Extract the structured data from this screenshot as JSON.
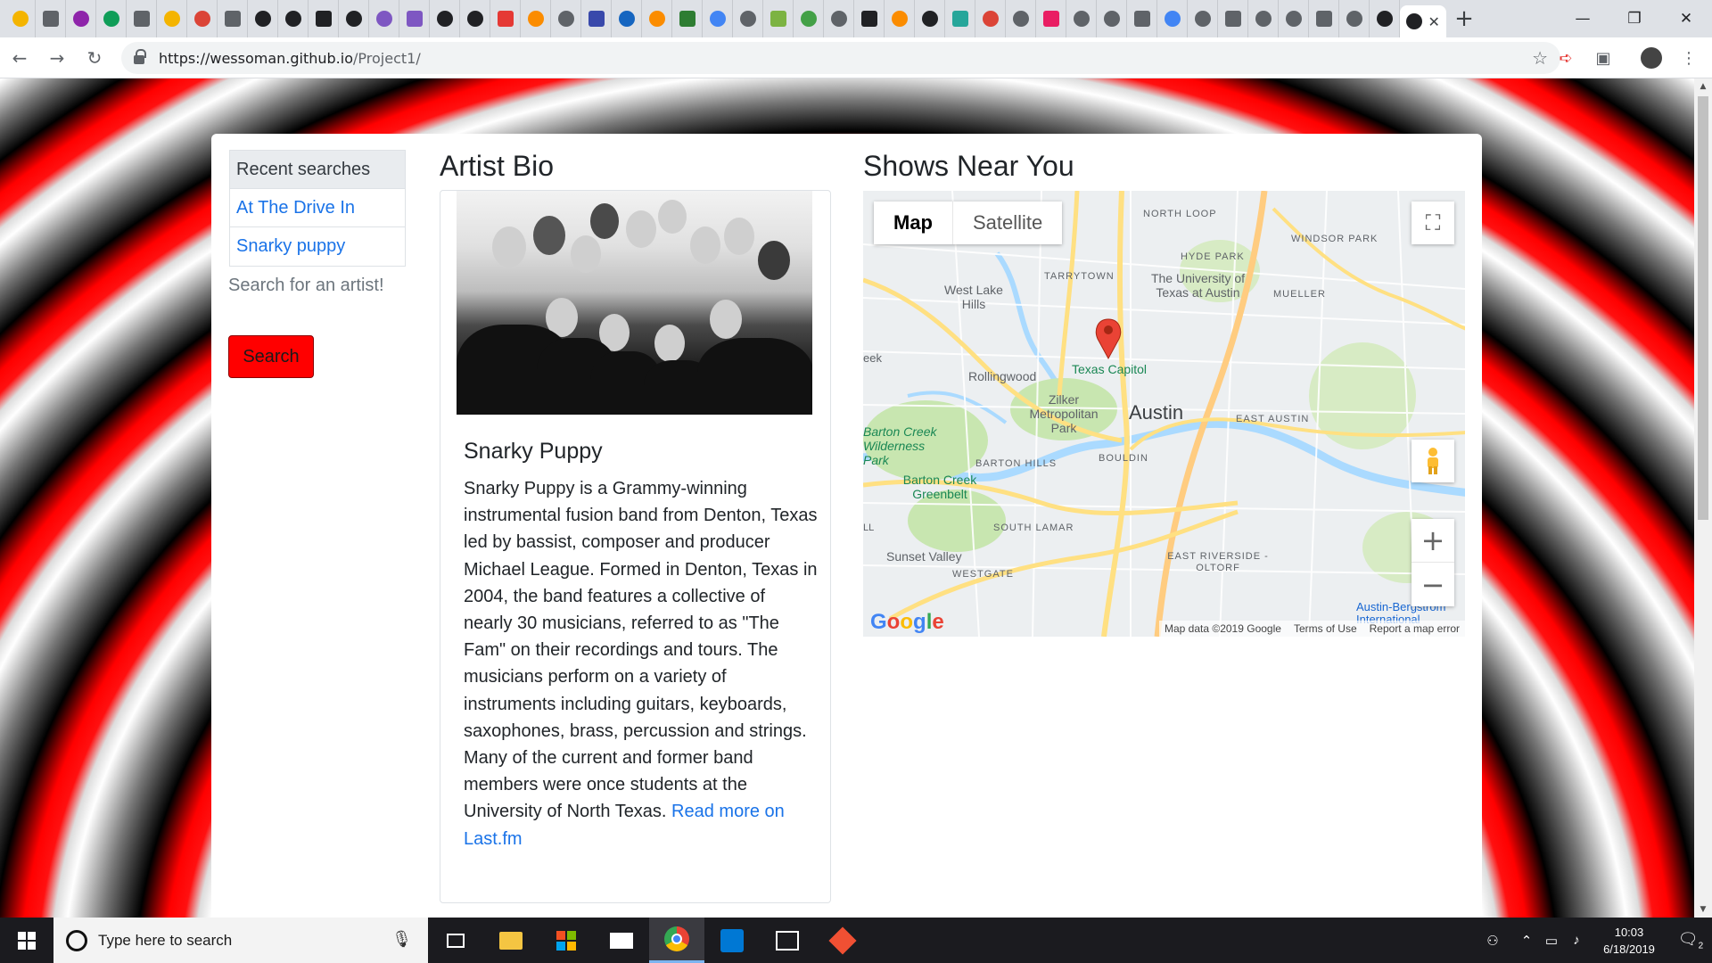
{
  "browser": {
    "url_host": "https://wessoman.github.io",
    "url_path": "/Project1/",
    "tab_count_left": 48
  },
  "sidebar": {
    "title": "Recent searches",
    "items": [
      {
        "label": "At The Drive In"
      },
      {
        "label": "Snarky puppy"
      }
    ],
    "prompt": "Search for an artist!",
    "search_button": "Search"
  },
  "bio": {
    "heading": "Artist Bio",
    "name": "Snarky Puppy",
    "text": "Snarky Puppy is a Grammy-winning instrumental fusion band from Denton, Texas led by bassist, composer and producer Michael League. Formed in Denton, Texas in 2004, the band features a collective of nearly 30 musicians, referred to as \"The Fam\" on their recordings and tours. The musicians perform on a variety of instruments including guitars, keyboards, saxophones, brass, percussion and strings. Many of the current and former band members were once students at the University of North Texas. ",
    "link": "Read more on Last.fm"
  },
  "shows": {
    "heading": "Shows Near You",
    "map_type_map": "Map",
    "map_type_satellite": "Satellite",
    "labels": {
      "north_loop": "NORTH LOOP",
      "windsor_park": "WINDSOR PARK",
      "hyde_park": "HYDE PARK",
      "tarrytown": "TARRYTOWN",
      "univ": "The University of Texas at Austin",
      "mueller": "MUELLER",
      "west_lake": "West Lake Hills",
      "rollingwood": "Rollingwood",
      "capitol": "Texas Capitol",
      "zilker": "Zilker Metropolitan Park",
      "austin": "Austin",
      "east_austin": "EAST AUSTIN",
      "barton_wild": "Barton Creek Wilderness Park",
      "barton_hills": "BARTON HILLS",
      "bouldin": "BOULDIN",
      "barton_green": "Barton Creek Greenbelt",
      "south_lamar": "SOUTH LAMAR",
      "sunset_valley": "Sunset Valley",
      "westgate": "WESTGATE",
      "east_riverside": "EAST RIVERSIDE - OLTORF",
      "airport": "Austin-Bergstrom International",
      "eek": "eek",
      "ll": "LL"
    },
    "google_logo": "Google",
    "attribution": [
      "Map data ©2019 Google",
      "Terms of Use",
      "Report a map error"
    ]
  },
  "taskbar": {
    "search_placeholder": "Type here to search",
    "time": "10:03",
    "date": "6/18/2019",
    "notifications": "2"
  }
}
